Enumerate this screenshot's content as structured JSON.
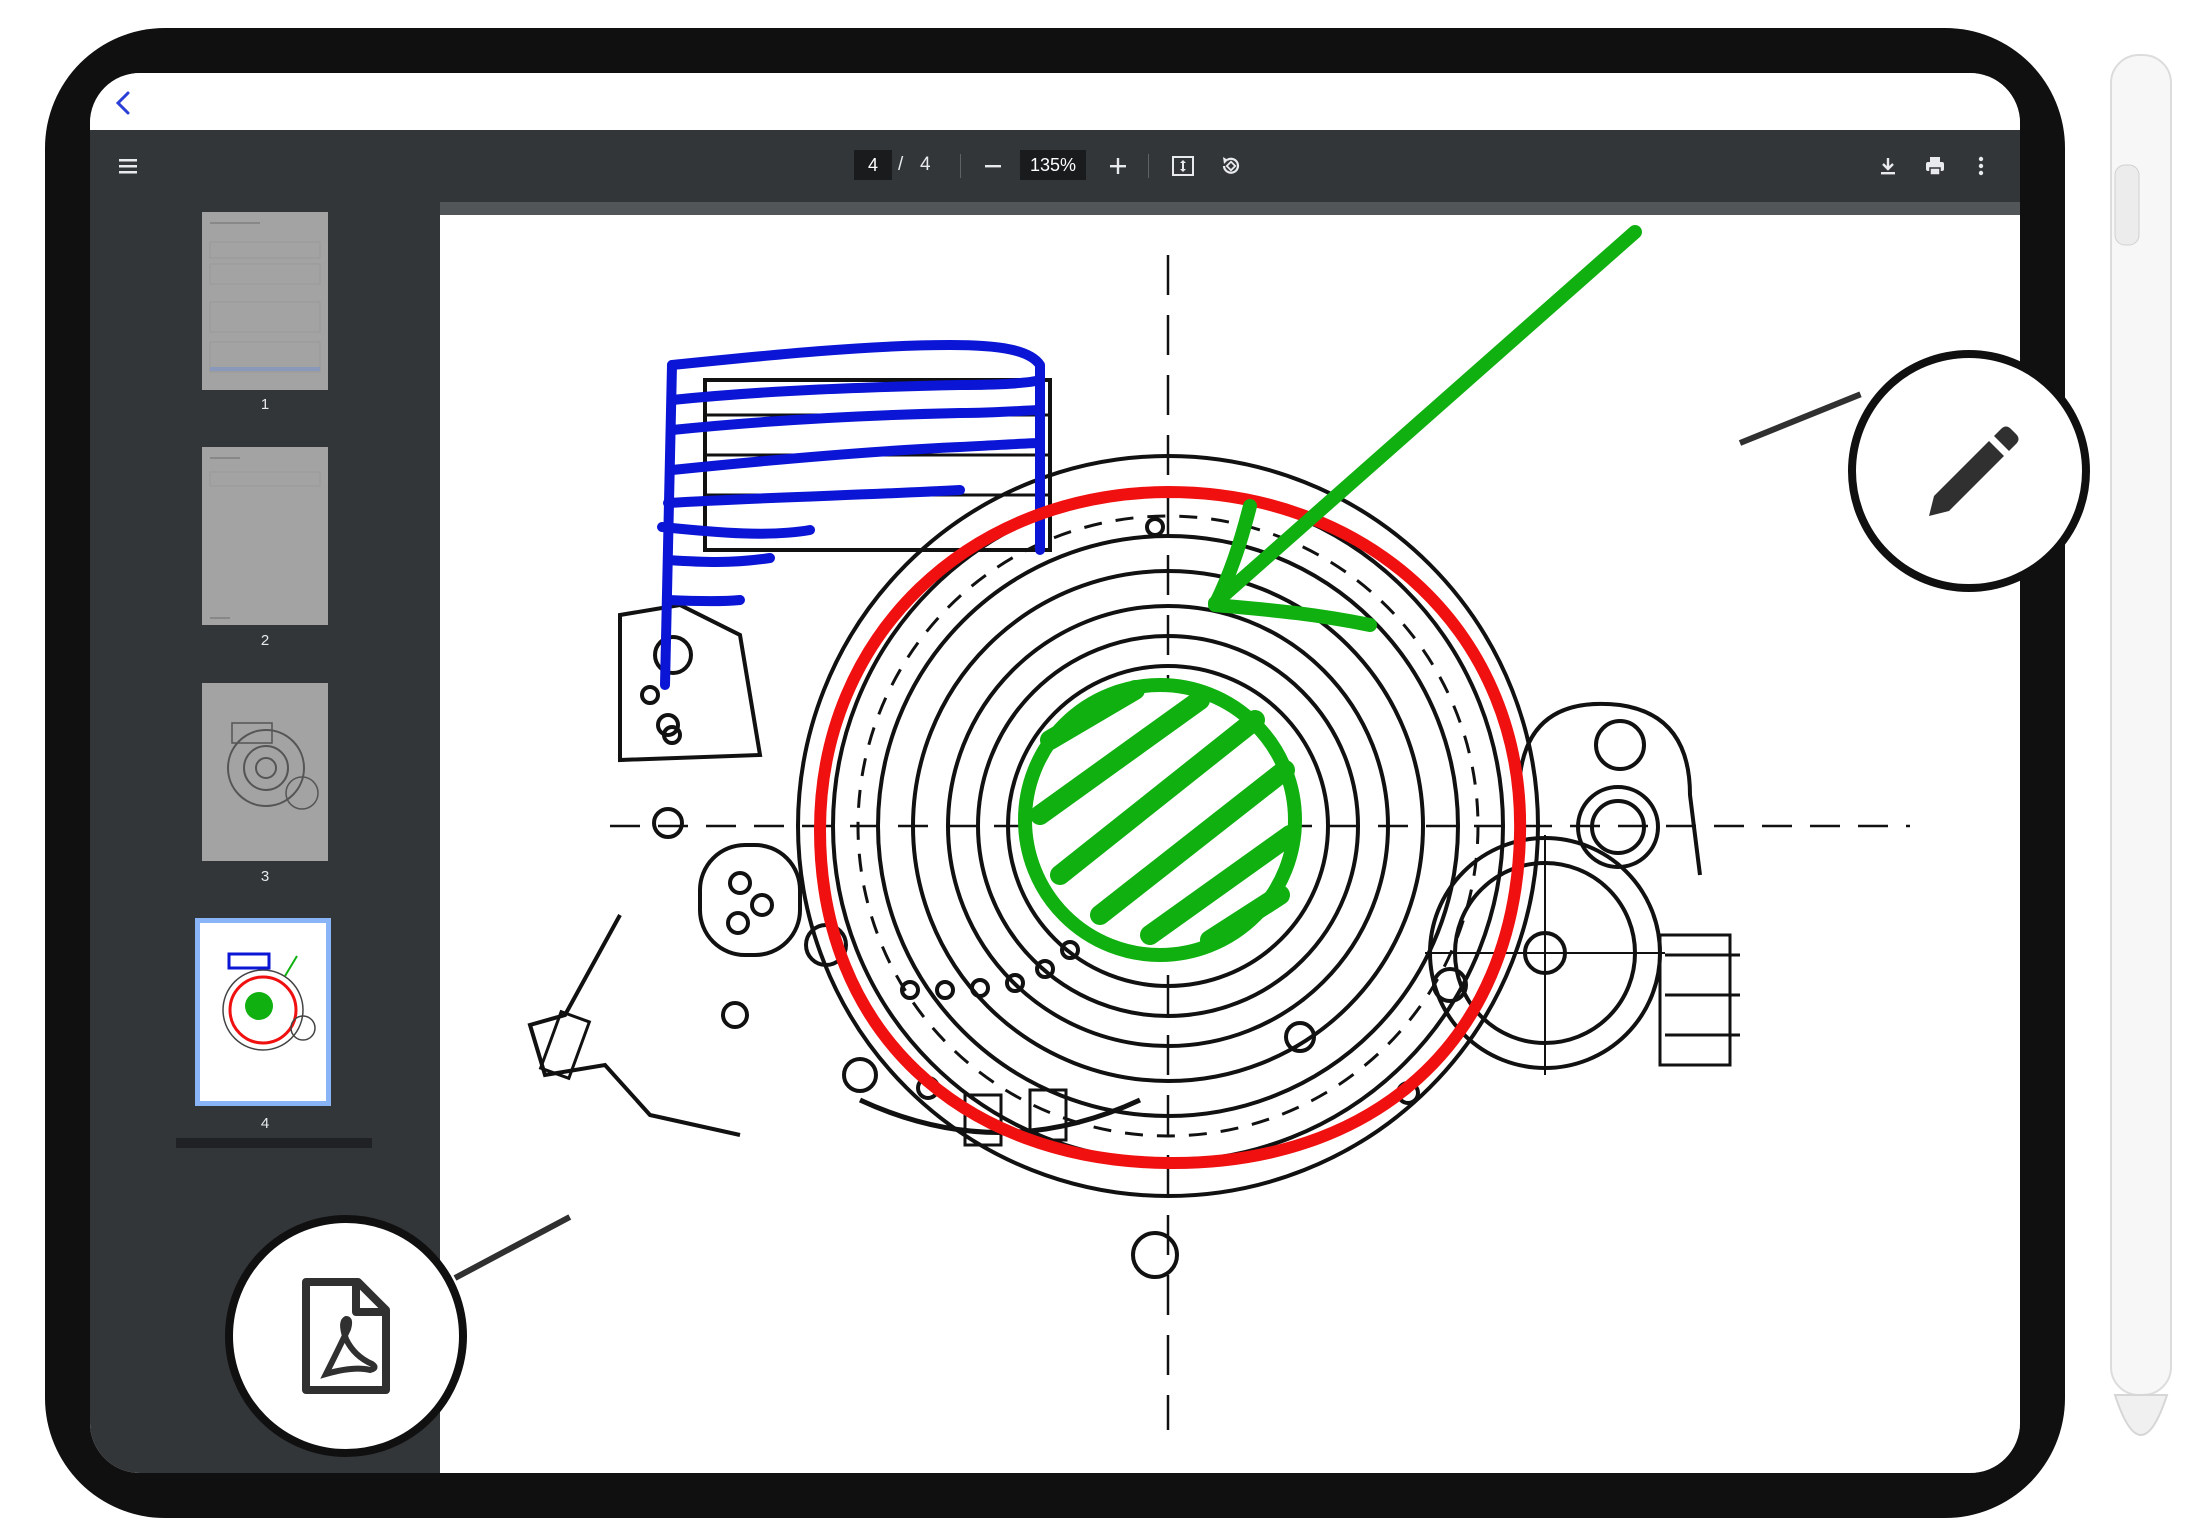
{
  "toolbar": {
    "current_page": "4",
    "page_separator": "/",
    "total_pages": "4",
    "zoom": "135%"
  },
  "sidebar": {
    "thumbnails": [
      {
        "label": "1"
      },
      {
        "label": "2"
      },
      {
        "label": "3"
      },
      {
        "label": "4",
        "selected": true
      }
    ]
  },
  "annotations": {
    "colors": {
      "blue": "#0a15d6",
      "red": "#f01010",
      "green": "#10b010"
    }
  },
  "icons": [
    "menu-icon",
    "zoom-out-icon",
    "zoom-in-icon",
    "fit-page-icon",
    "rotate-icon",
    "download-icon",
    "print-icon",
    "more-icon",
    "pdf-file-icon",
    "pencil-icon",
    "back-icon"
  ]
}
